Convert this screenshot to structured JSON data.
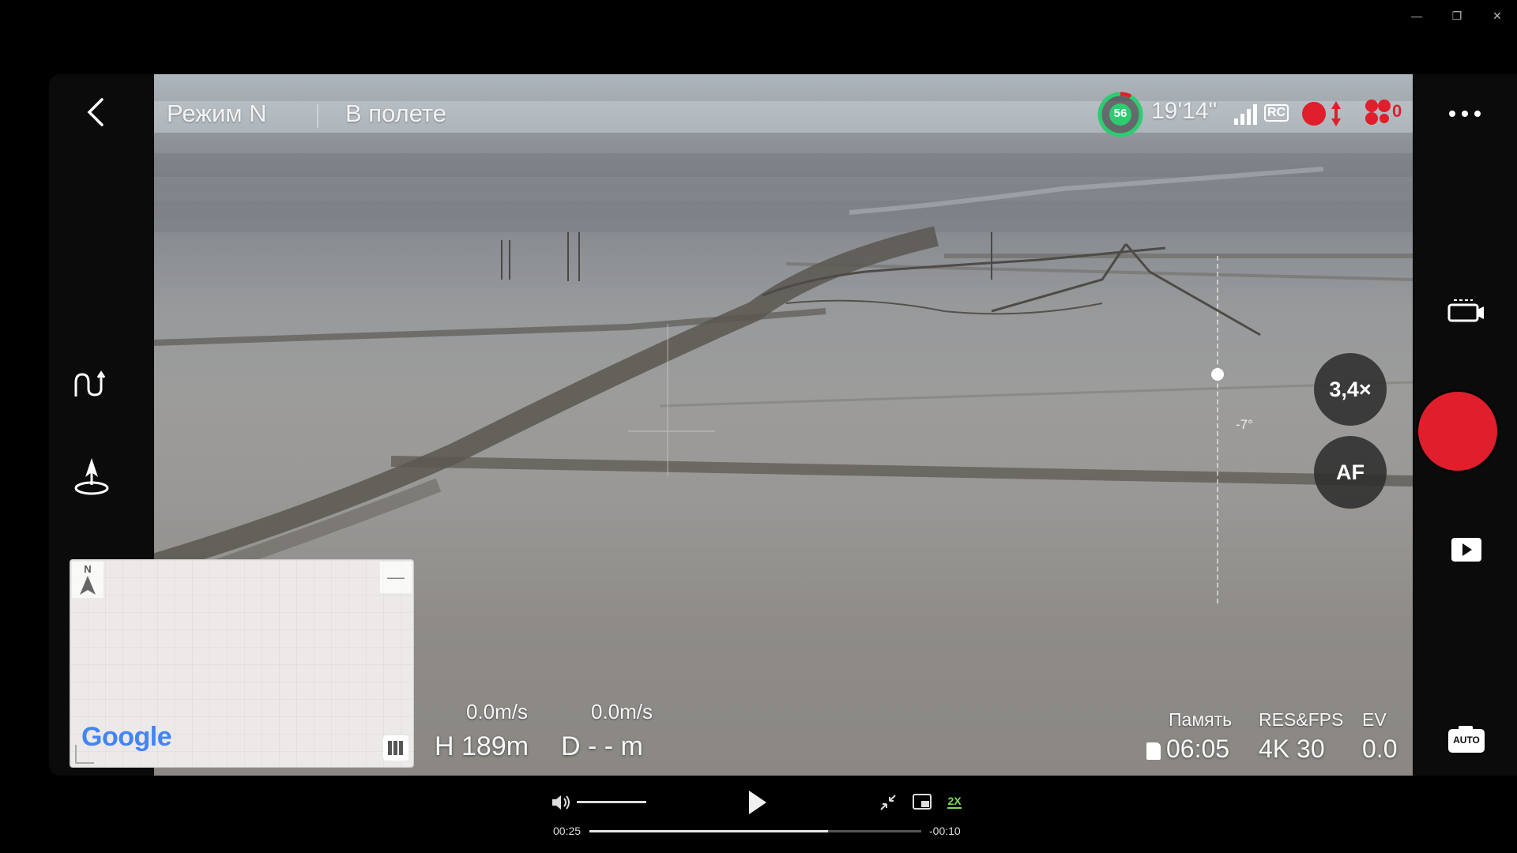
{
  "window": {
    "minimize_glyph": "—",
    "restore_glyph": "❐",
    "close_glyph": "✕"
  },
  "hud": {
    "mode_label": "Режим N",
    "flight_status": "В полете",
    "battery_percent": "56",
    "flight_time": "19'14\"",
    "rc_label": "RC",
    "obstacle_count": "0",
    "gimbal_angle": "-7°",
    "zoom_label": "3,4×",
    "focus_label": "AF",
    "auto_label": "AUTO",
    "accent_red": "#e01e2c",
    "battery_green": "#2ecc71"
  },
  "telemetry": {
    "h_speed": "0.0m/s",
    "v_speed": "0.0m/s",
    "height": "H 189m",
    "distance": "D - - m",
    "storage_label": "Память",
    "storage_value": "06:05",
    "resfps_label": "RES&FPS",
    "resfps_value": "4K 30",
    "ev_label": "EV",
    "ev_value": "0.0"
  },
  "map": {
    "north_label": "N",
    "logo_text": "Google",
    "collapse_glyph": "—"
  },
  "playback": {
    "elapsed": "00:25",
    "remaining": "-00:10",
    "progress_fraction": 0.72,
    "volume_fraction": 1.0,
    "speed_label": "2X"
  }
}
